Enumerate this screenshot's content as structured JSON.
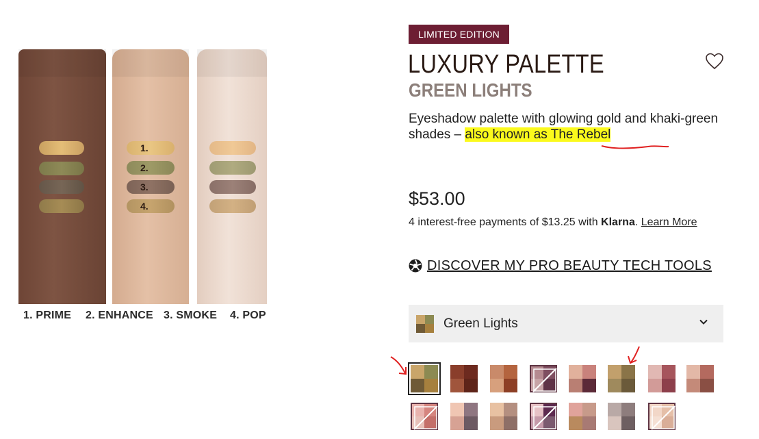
{
  "swatch_image": {
    "arm_numbers": [
      "1.",
      "2.",
      "3.",
      "4."
    ],
    "captions": [
      "1. PRIME",
      "2. ENHANCE",
      "3. SMOKE",
      "4. POP"
    ]
  },
  "product": {
    "badge": "LIMITED EDITION",
    "title": "LUXURY PALETTE",
    "subtitle": "GREEN LIGHTS",
    "description_prefix": "Eyeshadow palette with glowing gold and khaki-green shades – ",
    "description_highlight": "also known as The Rebel",
    "price": "$53.00",
    "klarna_prefix": "4 interest-free payments of $13.25 with ",
    "klarna_brand": "Klarna",
    "klarna_link": "Learn More",
    "discover_link": "DISCOVER MY PRO BEAUTY TECH TOOLS"
  },
  "shade_select": {
    "selected": "Green Lights",
    "thumb_colors": [
      "#c9a56a",
      "#8c8a52",
      "#6f5a36",
      "#a6803e"
    ]
  },
  "shades": [
    {
      "colors": [
        "#c9a56a",
        "#8c8a52",
        "#6f5a36",
        "#a6803e"
      ],
      "selected": true,
      "out_of_stock": false
    },
    {
      "colors": [
        "#8a3e2b",
        "#6d2a1f",
        "#a0553c",
        "#5e2419"
      ],
      "selected": false,
      "out_of_stock": false
    },
    {
      "colors": [
        "#c98a6a",
        "#b4643f",
        "#d7a07d",
        "#8d3f25"
      ],
      "selected": false,
      "out_of_stock": false
    },
    {
      "colors": [
        "#b58a90",
        "#7f4f61",
        "#c7a3a6",
        "#5f3347"
      ],
      "selected": false,
      "out_of_stock": true
    },
    {
      "colors": [
        "#e1b19c",
        "#c9827c",
        "#b97f73",
        "#5c2a38"
      ],
      "selected": false,
      "out_of_stock": false
    },
    {
      "colors": [
        "#c2a06c",
        "#8a7448",
        "#9f8a5d",
        "#6b5a3a"
      ],
      "selected": false,
      "out_of_stock": false
    },
    {
      "colors": [
        "#e1b8b3",
        "#a6555c",
        "#d29b98",
        "#8d3f4b"
      ],
      "selected": false,
      "out_of_stock": false
    },
    {
      "colors": [
        "#e3b8a7",
        "#b46a5f",
        "#c48a79",
        "#8a4f44"
      ],
      "selected": false,
      "out_of_stock": false
    },
    {
      "colors": [
        "#e9b3ae",
        "#d5857f",
        "#e7c0b9",
        "#c46f6a"
      ],
      "selected": false,
      "out_of_stock": true
    },
    {
      "colors": [
        "#f0c6b3",
        "#8f7681",
        "#d7a294",
        "#6d5a63"
      ],
      "selected": false,
      "out_of_stock": false
    },
    {
      "colors": [
        "#e8c1a2",
        "#b48f80",
        "#c99b7e",
        "#8e6f67"
      ],
      "selected": false,
      "out_of_stock": false
    },
    {
      "colors": [
        "#e7c2c6",
        "#5e2b50",
        "#c59aa9",
        "#7b5a6f"
      ],
      "selected": false,
      "out_of_stock": true
    },
    {
      "colors": [
        "#e0a39b",
        "#c79a8a",
        "#b98a5e",
        "#a87a74"
      ],
      "selected": false,
      "out_of_stock": false
    },
    {
      "colors": [
        "#b9a9a6",
        "#8e7d7d",
        "#d9c5be",
        "#6e5f61"
      ],
      "selected": false,
      "out_of_stock": false
    },
    {
      "colors": [
        "#f2d7c8",
        "#e5bfa8",
        "#f5e0d4",
        "#d9ae98"
      ],
      "selected": false,
      "out_of_stock": true
    }
  ],
  "colors": {
    "badge_bg": "#6d1e33",
    "highlight": "#fbfa1c",
    "annotation_red": "#e02020"
  }
}
